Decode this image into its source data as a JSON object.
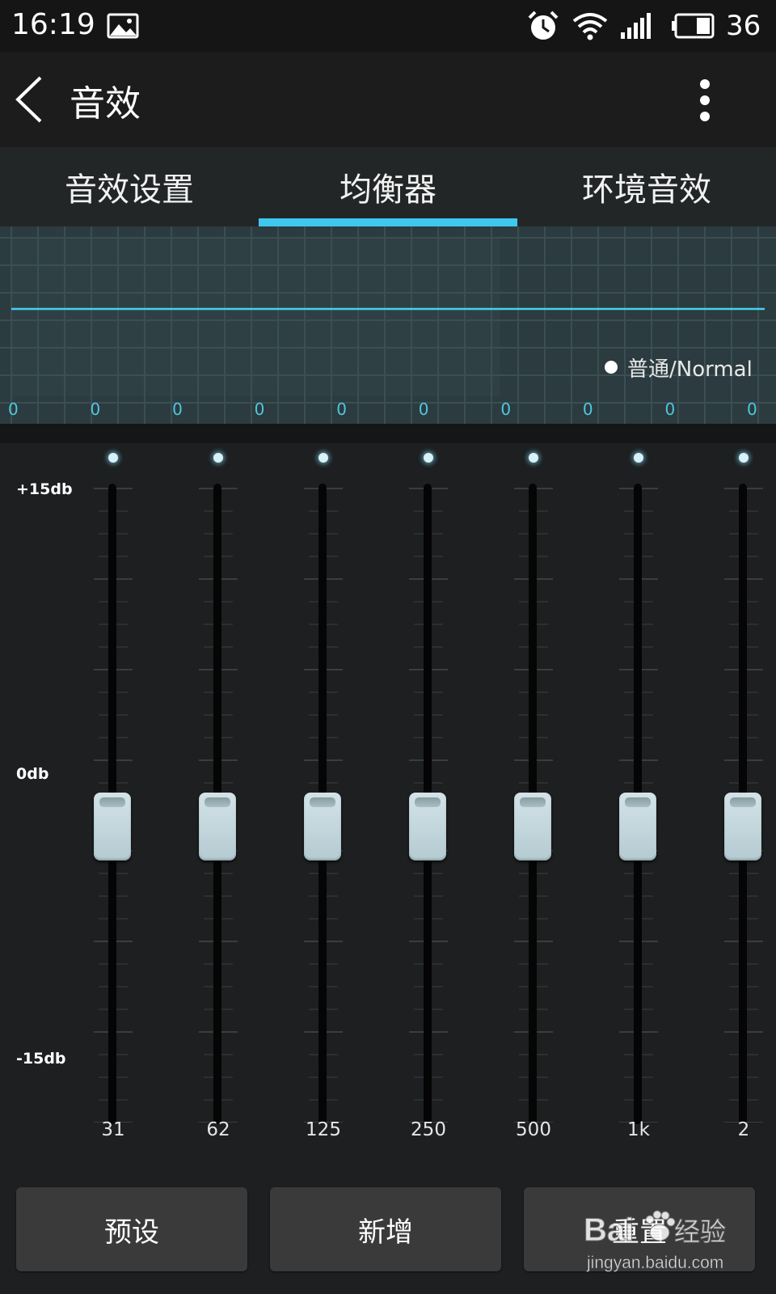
{
  "status_bar": {
    "time": "16:19",
    "battery": "36"
  },
  "app_bar": {
    "title": "音效"
  },
  "tabs": [
    {
      "label": "音效设置"
    },
    {
      "label": "均衡器",
      "active": true
    },
    {
      "label": "环境音效"
    }
  ],
  "curve": {
    "preset_label": "普通/Normal",
    "values": [
      "0",
      "0",
      "0",
      "0",
      "0",
      "0",
      "0",
      "0",
      "0",
      "0"
    ]
  },
  "eq": {
    "labels": {
      "max": "+15db",
      "mid": "0db",
      "min": "-15db"
    },
    "range_db": [
      -15,
      15
    ],
    "bands": [
      {
        "freq": "31",
        "gain_db": 0
      },
      {
        "freq": "62",
        "gain_db": 0
      },
      {
        "freq": "125",
        "gain_db": 0
      },
      {
        "freq": "250",
        "gain_db": 0
      },
      {
        "freq": "500",
        "gain_db": 0
      },
      {
        "freq": "1k",
        "gain_db": 0
      },
      {
        "freq": "2",
        "gain_db": 0
      }
    ]
  },
  "actions": {
    "preset": "预设",
    "add": "新增",
    "reset": "重置"
  },
  "watermark": {
    "brand": "Bai",
    "brand2": "经验",
    "url": "jingyan.baidu.com"
  },
  "colors": {
    "accent": "#3fc8ee",
    "curve_bg": "#2b3b3f",
    "button_bg": "#3a3a3a"
  }
}
